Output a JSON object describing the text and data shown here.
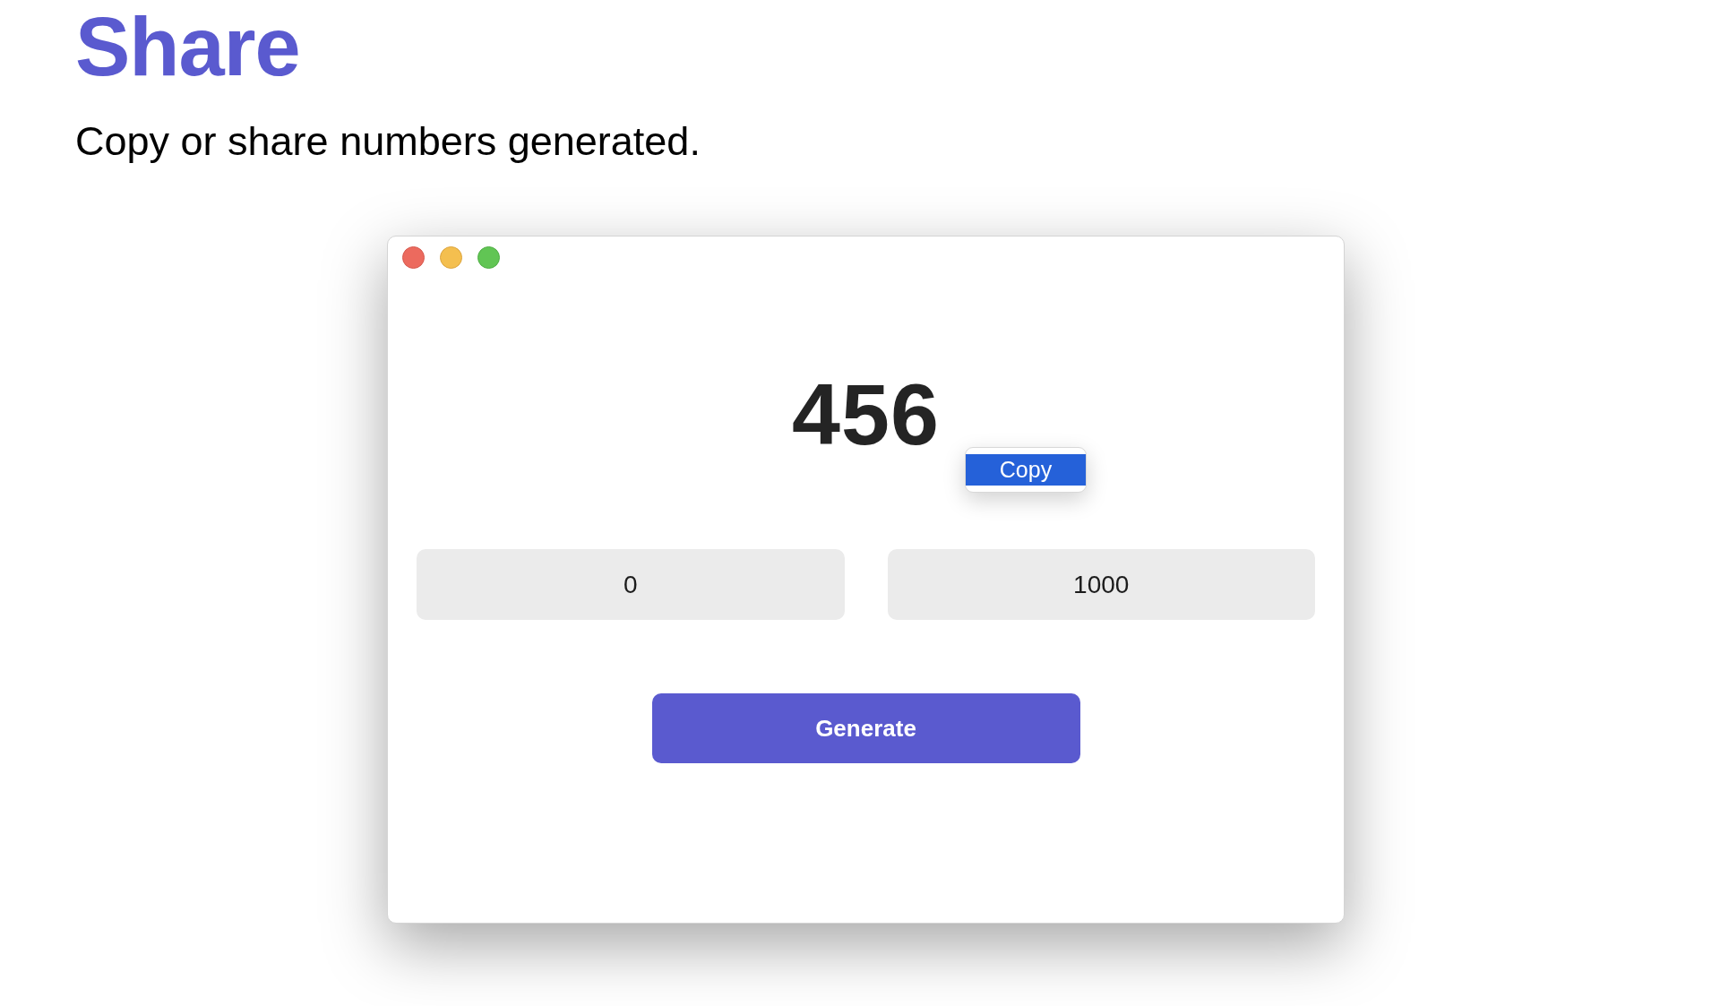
{
  "page": {
    "title": "Share",
    "subtitle": "Copy or share numbers generated."
  },
  "window": {
    "result": "456",
    "context_menu": {
      "items": [
        {
          "label": "Copy",
          "selected": true
        }
      ]
    },
    "fields": [
      {
        "value": "0"
      },
      {
        "value": "1000"
      }
    ],
    "generate_button": {
      "label": "Generate"
    }
  }
}
